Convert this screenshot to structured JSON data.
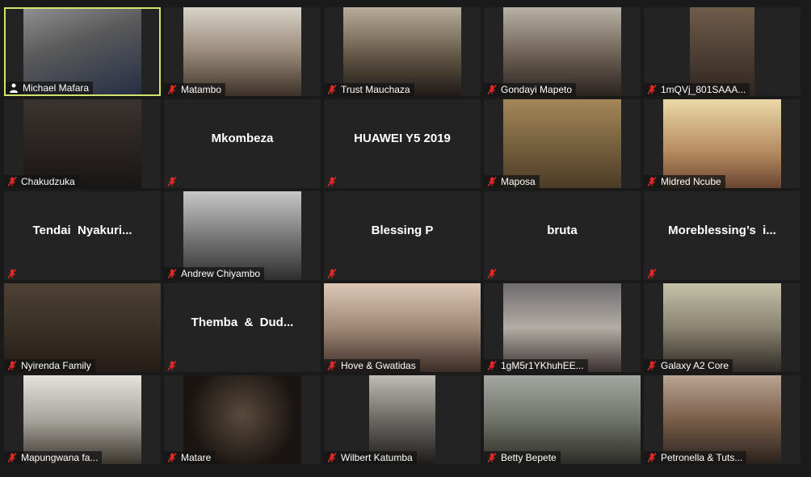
{
  "colors": {
    "background": "#1a1a1a",
    "tile": "#232323",
    "active_speaker_border": "#d6e36a",
    "muted_icon": "#e02828"
  },
  "active_speaker_icon": "person-icon",
  "muted_icon": "muted-mic-icon",
  "participants": [
    {
      "name": "Michael Mafara",
      "video": true,
      "active_speaker": true
    },
    {
      "name": "Matambo",
      "video": true
    },
    {
      "name": "Trust Mauchaza",
      "video": true
    },
    {
      "name": "Gondayi Mapeto",
      "video": true
    },
    {
      "name": "1mQVj_801SAAA...",
      "video": true
    },
    {
      "name": "Chakudzuka",
      "video": true
    },
    {
      "name": "Mkombeza",
      "video": false
    },
    {
      "name": "HUAWEI Y5 2019",
      "video": false
    },
    {
      "name": "Maposa",
      "video": true
    },
    {
      "name": "Midred Ncube",
      "video": true
    },
    {
      "name": "Tendai  Nyakuri...",
      "video": false
    },
    {
      "name": "Andrew Chiyambo",
      "video": true
    },
    {
      "name": "Blessing P",
      "video": false
    },
    {
      "name": "bruta",
      "video": false
    },
    {
      "name": "Moreblessing’s  i...",
      "video": false
    },
    {
      "name": "Nyirenda Family",
      "video": true
    },
    {
      "name": "Themba  &  Dud...",
      "video": false
    },
    {
      "name": "Hove & Gwatidas",
      "video": true
    },
    {
      "name": "1gM5r1YKhuhEE...",
      "video": true
    },
    {
      "name": "Galaxy A2 Core",
      "video": true
    },
    {
      "name": "Mapungwana fa...",
      "video": true
    },
    {
      "name": "Matare",
      "video": true
    },
    {
      "name": "Wilbert Katumba",
      "video": true
    },
    {
      "name": "Betty Bepete",
      "video": true
    },
    {
      "name": "Petronella & Tuts...",
      "video": true
    }
  ]
}
